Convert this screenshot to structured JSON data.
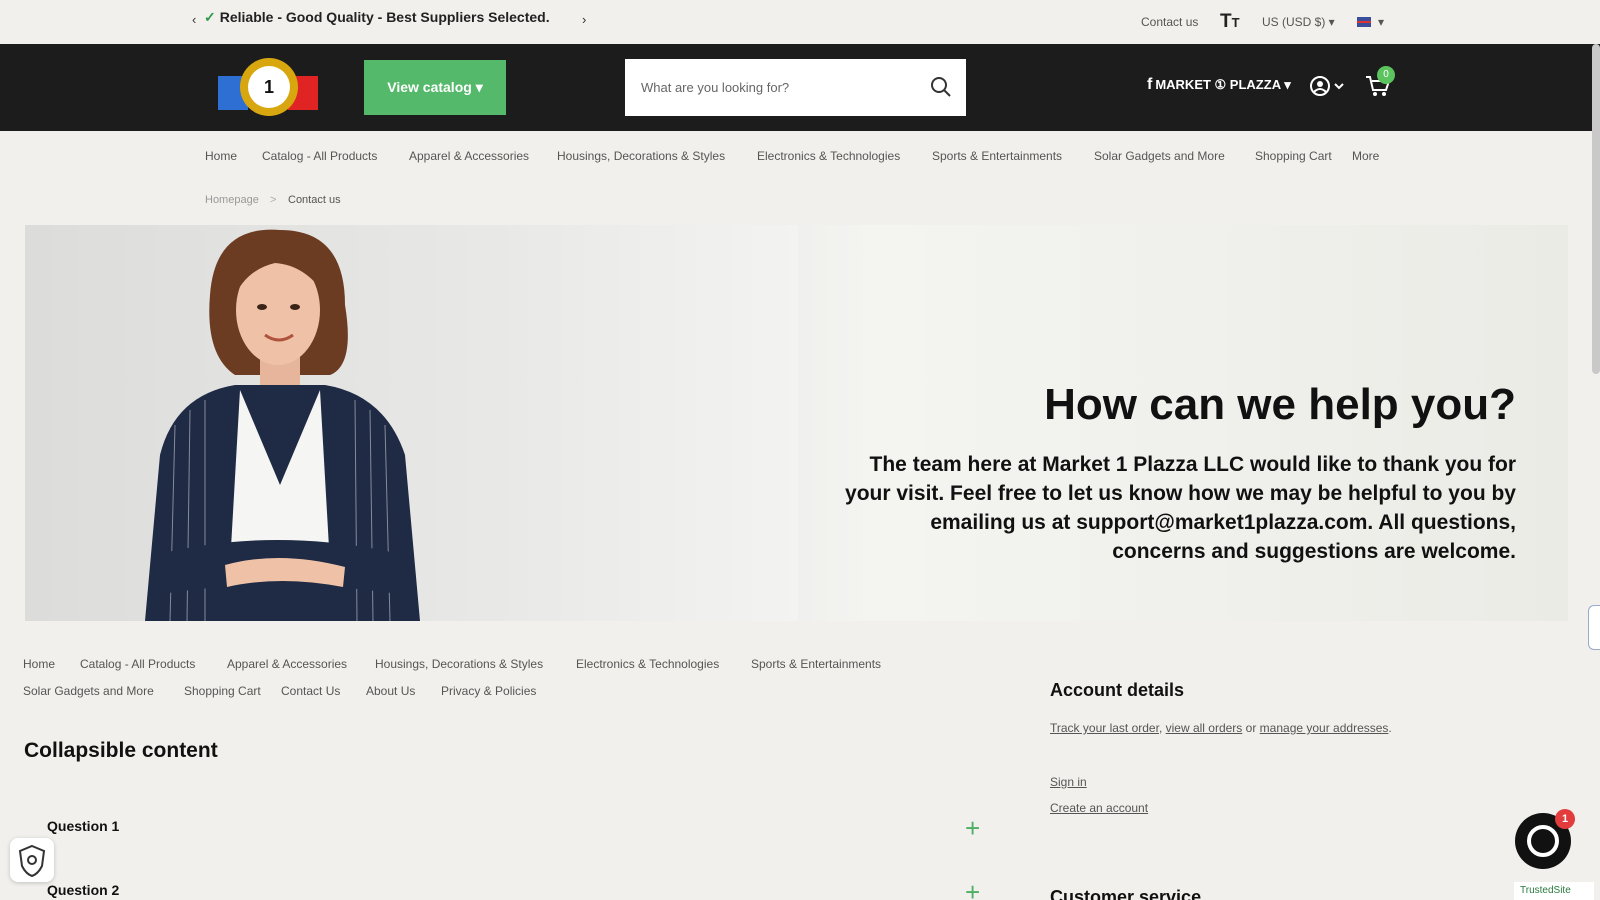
{
  "topbar": {
    "prev_arrow": "‹",
    "next_arrow": "›",
    "announcement": "Reliable - Good Quality - Best Suppliers Selected.",
    "contact": "Contact us",
    "text_size_icon": "text-size-icon",
    "currency": "US (USD $)"
  },
  "header": {
    "logo_text": "1",
    "catalog_button": "View catalog",
    "search_placeholder": "What are you looking for?",
    "facebook_label": "MARKET ① PLAZZA",
    "cart_count": "0"
  },
  "nav": {
    "items": [
      "Home",
      "Catalog - All Products",
      "Apparel & Accessories",
      "Housings, Decorations & Styles",
      "Electronics & Technologies",
      "Sports & Entertainments",
      "Solar Gadgets and More",
      "Shopping Cart",
      "More"
    ]
  },
  "breadcrumb": {
    "home": "Homepage",
    "separator": ">",
    "current": "Contact us"
  },
  "hero": {
    "title": "How can we help you?",
    "text": "The team here at Market 1 Plazza LLC would like to thank you for your visit. Feel free to let us know how we may be helpful to you by emailing us at support@market1plazza.com. All questions, concerns  and suggestions are welcome."
  },
  "footer_links": {
    "row1": [
      "Home",
      "Catalog - All Products",
      "Apparel & Accessories",
      "Housings, Decorations & Styles",
      "Electronics & Technologies",
      "Sports & Entertainments"
    ],
    "row2": [
      "Solar Gadgets and More",
      "Shopping Cart",
      "Contact Us",
      "About Us",
      "Privacy & Policies"
    ]
  },
  "collapsible": {
    "title": "Collapsible content",
    "questions": [
      "Question 1",
      "Question 2"
    ]
  },
  "account": {
    "title": "Account details",
    "track_link": "Track your last order",
    "view_link": "view all orders",
    "or_text": "or",
    "manage_link": "manage your addresses",
    "sign_in": "Sign in",
    "create": "Create an account"
  },
  "customer_service": {
    "title": "Customer service"
  },
  "chat": {
    "unread": "1"
  },
  "trusted": {
    "label": "TrustedSite"
  }
}
